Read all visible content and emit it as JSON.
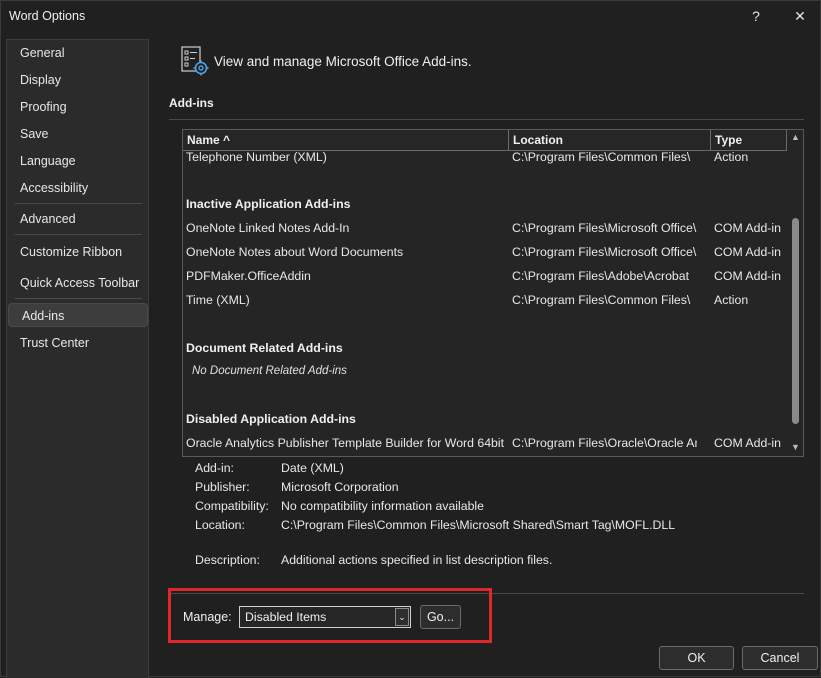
{
  "window": {
    "title": "Word Options",
    "help_glyph": "?",
    "close_glyph": "✕"
  },
  "sidebar": {
    "items": [
      {
        "label": "General"
      },
      {
        "label": "Display"
      },
      {
        "label": "Proofing"
      },
      {
        "label": "Save"
      },
      {
        "label": "Language"
      },
      {
        "label": "Accessibility"
      },
      {
        "label": "Advanced"
      },
      {
        "label": "Customize Ribbon"
      },
      {
        "label": "Quick Access Toolbar"
      },
      {
        "label": "Add-ins",
        "selected": true
      },
      {
        "label": "Trust Center"
      }
    ]
  },
  "header": {
    "icon": "addins-gear-icon",
    "text": "View and manage Microsoft Office Add-ins."
  },
  "section": {
    "title": "Add-ins"
  },
  "table": {
    "columns": [
      "Name ^",
      "Location",
      "Type"
    ],
    "partial_row": {
      "name": "Telephone Number (XML)",
      "location": "C:\\Program Files\\Common Files\\",
      "type": "Action"
    },
    "groups": [
      {
        "title": "Inactive Application Add-ins",
        "rows": [
          {
            "name": "OneNote Linked Notes Add-In",
            "location": "C:\\Program Files\\Microsoft Office\\",
            "type": "COM Add-in"
          },
          {
            "name": "OneNote Notes about Word Documents",
            "location": "C:\\Program Files\\Microsoft Office\\",
            "type": "COM Add-in"
          },
          {
            "name": "PDFMaker.OfficeAddin",
            "location": "C:\\Program Files\\Adobe\\Acrobat",
            "type": "COM Add-in"
          },
          {
            "name": "Time (XML)",
            "location": "C:\\Program Files\\Common Files\\",
            "type": "Action"
          }
        ]
      },
      {
        "title": "Document Related Add-ins",
        "note": "No Document Related Add-ins"
      },
      {
        "title": "Disabled Application Add-ins",
        "rows": [
          {
            "name": "Oracle Analytics Publisher Template Builder for Word 64bit",
            "location": "C:\\Program Files\\Oracle\\Oracle An",
            "type": "COM Add-in"
          }
        ]
      }
    ],
    "scroll_up_glyph": "▲",
    "scroll_down_glyph": "▼"
  },
  "details": {
    "addin_label": "Add-in:",
    "addin_value": "Date (XML)",
    "publisher_label": "Publisher:",
    "publisher_value": "Microsoft Corporation",
    "compat_label": "Compatibility:",
    "compat_value": "No compatibility information available",
    "location_label": "Location:",
    "location_value": "C:\\Program Files\\Common Files\\Microsoft Shared\\Smart Tag\\MOFL.DLL",
    "description_label": "Description:",
    "description_value": "Additional actions specified in list description files."
  },
  "manage": {
    "label": "Manage:",
    "selected": "Disabled Items",
    "dropdown_glyph": "⌄",
    "go_label": "Go..."
  },
  "footer": {
    "ok_label": "OK",
    "cancel_label": "Cancel"
  },
  "colors": {
    "highlight_border": "#e0262d",
    "background": "#202020",
    "sidebar_bg": "#2b2b2b"
  }
}
